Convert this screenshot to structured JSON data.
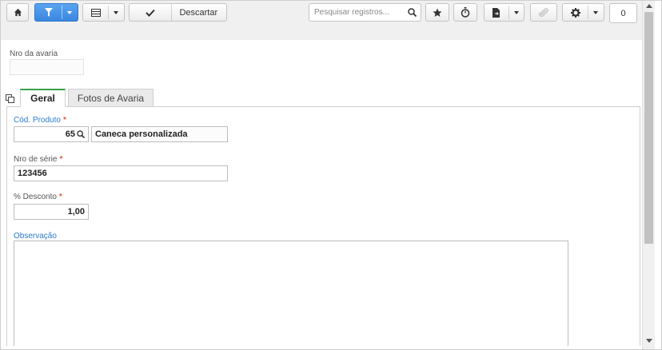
{
  "toolbar": {
    "discard_label": "Descartar",
    "search_placeholder": "Pesquisar registros...",
    "counter_value": "0"
  },
  "header": {
    "nro_avaria_label": "Nro da avaria",
    "nro_avaria_value": ""
  },
  "tabs": [
    {
      "label": "Geral",
      "active": true
    },
    {
      "label": "Fotos de Avaria",
      "active": false
    }
  ],
  "form": {
    "cod_produto_label": "Cód. Produto",
    "cod_produto_value": "65",
    "produto_nome_value": "Caneca personalizada",
    "nro_serie_label": "Nro de série",
    "nro_serie_value": "123456",
    "desconto_label": "% Desconto",
    "desconto_value": "1,00",
    "observacao_label": "Observação",
    "observacao_value": "",
    "required_mark": "*"
  },
  "colors": {
    "accent": "#3a86de",
    "active_tab": "#3ba04a",
    "required": "#e05a3a",
    "link_label": "#2a7bd0"
  }
}
